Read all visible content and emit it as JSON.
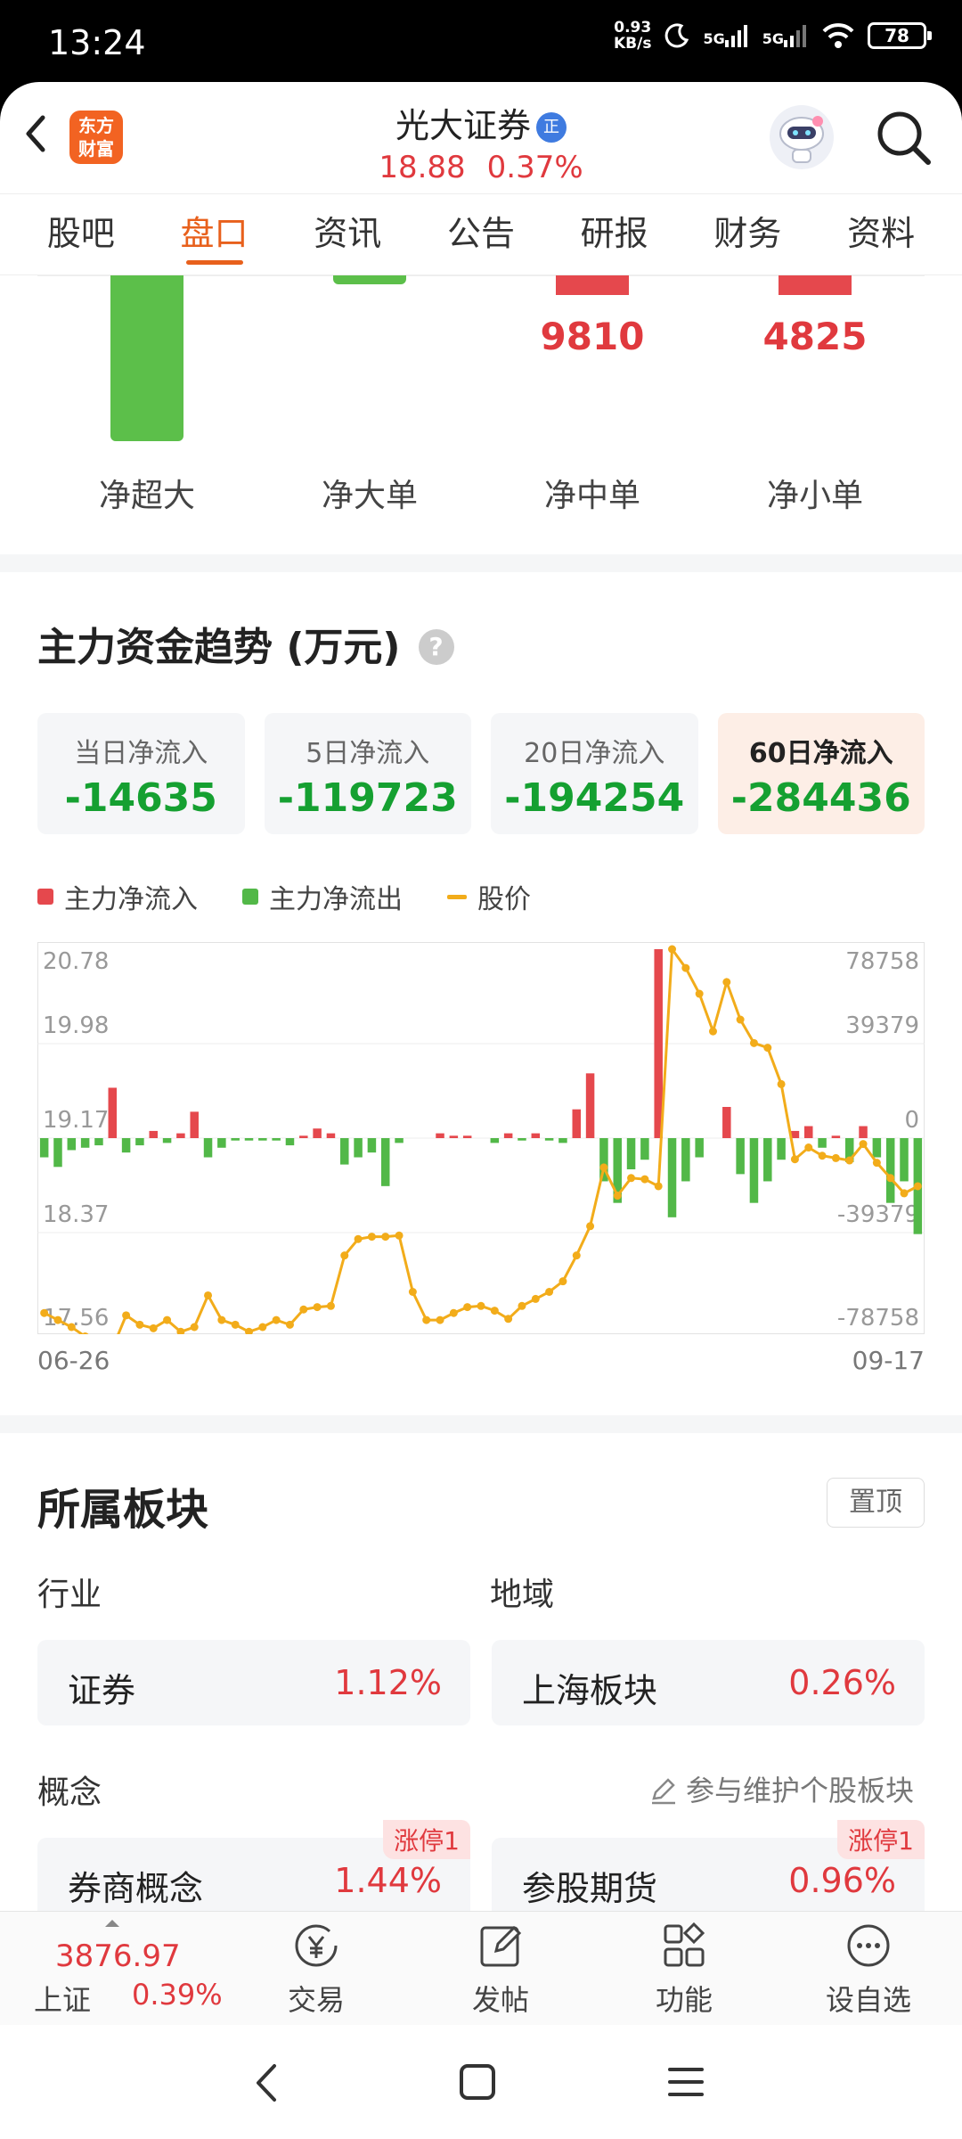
{
  "status_bar": {
    "time": "13:24",
    "net_speed_value": "0.93",
    "net_speed_unit": "KB/s",
    "signal1": "5G",
    "signal2": "5G",
    "battery": "78"
  },
  "header": {
    "logo_line1": "东方",
    "logo_line2": "财富",
    "stock_name": "光大证券",
    "badge": "正",
    "price": "18.88",
    "change_pct": "0.37%"
  },
  "tabs": [
    {
      "label": "股吧"
    },
    {
      "label": "盘口",
      "active": true
    },
    {
      "label": "资讯"
    },
    {
      "label": "公告"
    },
    {
      "label": "研报"
    },
    {
      "label": "财务"
    },
    {
      "label": "资料"
    }
  ],
  "flow_summary": {
    "items": [
      {
        "label": "净超大",
        "value": "",
        "color": "#5cbf4a"
      },
      {
        "label": "净大单",
        "value": "",
        "color": "#5cbf4a"
      },
      {
        "label": "净中单",
        "value": "9810",
        "color": "#e5484d"
      },
      {
        "label": "净小单",
        "value": "4825",
        "color": "#e5484d"
      }
    ]
  },
  "trend": {
    "title": "主力资金趋势 (万元)",
    "help": "?",
    "cards": [
      {
        "label": "当日净流入",
        "value": "-14635"
      },
      {
        "label": "5日净流入",
        "value": "-119723"
      },
      {
        "label": "20日净流入",
        "value": "-194254"
      },
      {
        "label": "60日净流入",
        "value": "-284436",
        "active": true
      }
    ],
    "legend": {
      "inflow": "主力净流入",
      "outflow": "主力净流出",
      "price": "股价"
    },
    "colors": {
      "inflow": "#e5484d",
      "outflow": "#52b848",
      "price": "#f2ac1a"
    }
  },
  "chart_data": {
    "type": "bar",
    "left_axis_ticks": [
      "20.78",
      "19.98",
      "19.17",
      "18.37",
      "17.56"
    ],
    "right_axis_ticks": [
      "78758",
      "39379",
      "0",
      "-39379",
      "-78758"
    ],
    "price_range": [
      17.56,
      20.78
    ],
    "flow_range": [
      -78758,
      78758
    ],
    "x_start": "06-26",
    "x_end": "09-17",
    "series": [
      {
        "name": "主力净流入/主力净流出",
        "values": [
          -8000,
          -12000,
          -5000,
          -4000,
          -3000,
          21000,
          -6000,
          -3000,
          3000,
          -2000,
          2000,
          11000,
          -8000,
          -4000,
          -1000,
          -1000,
          -1000,
          -1000,
          -3000,
          1000,
          4000,
          2000,
          -11000,
          -8000,
          -6000,
          -20000,
          -2000,
          0,
          0,
          2000,
          1000,
          1000,
          0,
          -2000,
          2000,
          -1000,
          2000,
          -1000,
          -2000,
          12000,
          27000,
          -18000,
          -27000,
          -13000,
          -9000,
          78758,
          -33000,
          -18000,
          -8000,
          0,
          13000,
          -15000,
          -27000,
          -18000,
          -9000,
          3000,
          5000,
          -4000,
          1000,
          -10000,
          5000,
          -8000,
          -27000,
          -18000,
          -40000
        ]
      },
      {
        "name": "股价",
        "values": [
          17.68,
          17.62,
          17.56,
          17.48,
          17.42,
          17.38,
          17.66,
          17.58,
          17.55,
          17.62,
          17.52,
          17.56,
          17.83,
          17.62,
          17.58,
          17.52,
          17.56,
          17.62,
          17.58,
          17.71,
          17.73,
          17.74,
          18.17,
          18.31,
          18.33,
          18.33,
          18.34,
          17.86,
          17.62,
          17.62,
          17.68,
          17.73,
          17.74,
          17.7,
          17.63,
          17.74,
          17.8,
          17.86,
          17.95,
          18.17,
          18.42,
          18.92,
          18.68,
          18.83,
          18.82,
          18.76,
          20.78,
          20.62,
          20.4,
          20.08,
          20.5,
          20.18,
          19.98,
          19.94,
          19.63,
          18.99,
          19.09,
          19.02,
          19.0,
          18.98,
          19.12,
          18.96,
          18.83,
          18.7,
          18.76
        ]
      }
    ]
  },
  "sectors": {
    "title": "所属板块",
    "pin_label": "置顶",
    "industry_label": "行业",
    "region_label": "地域",
    "industry": {
      "name": "证券",
      "pct": "1.12%"
    },
    "region": {
      "name": "上海板块",
      "pct": "0.26%"
    },
    "concept_label": "概念",
    "maintain_link": "参与维护个股板块",
    "concepts": [
      {
        "name": "券商概念",
        "pct": "1.44%",
        "tag": "涨停1"
      },
      {
        "name": "参股期货",
        "pct": "0.96%",
        "tag": "涨停1"
      }
    ]
  },
  "bottom_bar": {
    "index_price": "3876.97",
    "index_name": "上证",
    "index_pct": "0.39%",
    "buttons": [
      {
        "label": "交易",
        "icon": "trade-icon"
      },
      {
        "label": "发帖",
        "icon": "post-icon"
      },
      {
        "label": "功能",
        "icon": "function-icon"
      },
      {
        "label": "设自选",
        "icon": "watchlist-icon"
      }
    ]
  }
}
